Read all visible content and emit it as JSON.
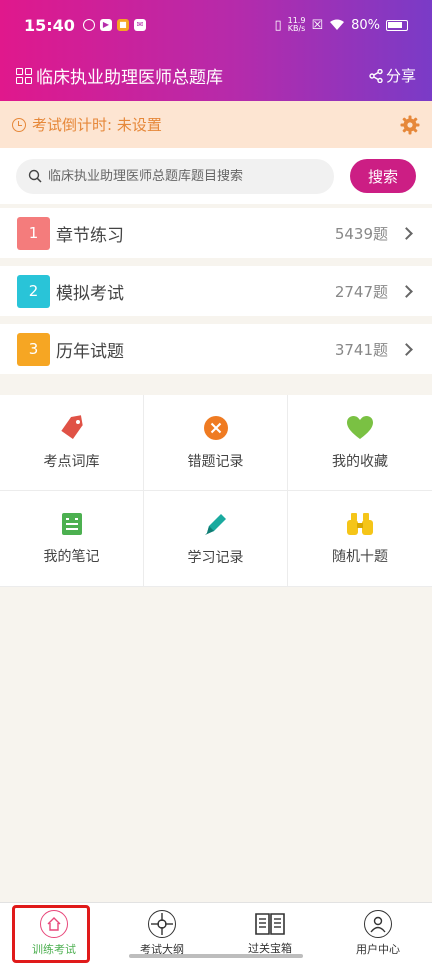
{
  "status_bar": {
    "time": "15:40",
    "speed_value": "11.9",
    "speed_unit": "KB/s",
    "battery": "80%"
  },
  "header": {
    "title": "临床执业助理医师总题库",
    "share_label": "分享"
  },
  "countdown": {
    "label": "考试倒计时: 未设置"
  },
  "search": {
    "placeholder": "临床执业助理医师总题库题目搜索",
    "button_label": "搜索"
  },
  "menu": [
    {
      "num": "1",
      "label": "章节练习",
      "count": "5439题",
      "color": "#f47c7c"
    },
    {
      "num": "2",
      "label": "模拟考试",
      "count": "2747题",
      "color": "#29c4d8"
    },
    {
      "num": "3",
      "label": "历年试题",
      "count": "3741题",
      "color": "#f6a623"
    }
  ],
  "tools": [
    {
      "label": "考点词库",
      "icon": "tag-icon",
      "color": "#e05246"
    },
    {
      "label": "错题记录",
      "icon": "x-circle-icon",
      "color": "#ef7b22"
    },
    {
      "label": "我的收藏",
      "icon": "heart-icon",
      "color": "#7ac143"
    },
    {
      "label": "我的笔记",
      "icon": "note-icon",
      "color": "#4cb050"
    },
    {
      "label": "学习记录",
      "icon": "pencil-icon",
      "color": "#1aaa9f"
    },
    {
      "label": "随机十题",
      "icon": "binoculars-icon",
      "color": "#f5c518"
    }
  ],
  "tabs": [
    {
      "label": "训练考试",
      "icon": "home-icon",
      "active": true
    },
    {
      "label": "考试大纲",
      "icon": "target-icon",
      "active": false
    },
    {
      "label": "过关宝箱",
      "icon": "book-icon",
      "active": false
    },
    {
      "label": "用户中心",
      "icon": "user-icon",
      "active": false
    }
  ]
}
